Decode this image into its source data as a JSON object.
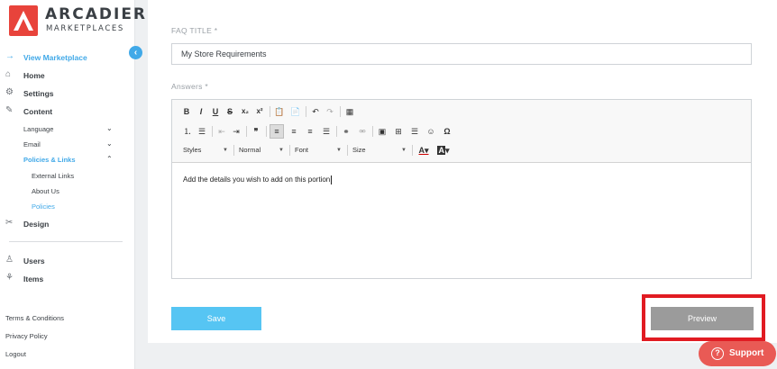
{
  "brand": {
    "name": "ARCADIER",
    "tagline": "MARKETPLACES",
    "color": "#e8433b"
  },
  "sidebar": {
    "collapse_icon": "‹",
    "nav": [
      {
        "label": "View Marketplace",
        "icon": "→",
        "icon_name": "external-link-icon"
      },
      {
        "label": "Home",
        "icon": "⌂",
        "icon_name": "home-icon"
      },
      {
        "label": "Settings",
        "icon": "⚙",
        "icon_name": "gear-icon"
      },
      {
        "label": "Content",
        "icon": "✎",
        "icon_name": "content-edit-icon"
      }
    ],
    "content_sub": [
      {
        "label": "Language",
        "chevron": "⌄"
      },
      {
        "label": "Email",
        "chevron": "⌄"
      },
      {
        "label": "Policies & Links",
        "chevron": "⌃"
      }
    ],
    "policies_sub": [
      {
        "label": "External Links"
      },
      {
        "label": "About Us"
      },
      {
        "label": "Policies"
      }
    ],
    "design": {
      "label": "Design",
      "icon": "✂",
      "icon_name": "design-tools-icon"
    },
    "users": {
      "label": "Users",
      "icon": "♙",
      "icon_name": "user-icon"
    },
    "items": {
      "label": "Items",
      "icon": "⚘",
      "icon_name": "items-icon"
    },
    "footer": [
      "Terms & Conditions",
      "Privacy Policy",
      "Logout"
    ]
  },
  "form": {
    "faq_title_label": "FAQ TITLE *",
    "faq_title_value": "My Store Requirements",
    "answers_label": "Answers *",
    "editor_content": "Add the details you wish to add on this portion",
    "toolbar_dropdowns": {
      "styles": "Styles",
      "format": "Normal",
      "font": "Font",
      "size": "Size"
    },
    "save_label": "Save",
    "preview_label": "Preview"
  },
  "support": {
    "label": "Support",
    "icon": "?"
  },
  "colors": {
    "accent": "#41a9e8",
    "save": "#56c5f3",
    "preview": "#9b9b9b",
    "highlight": "#e11b22",
    "support": "#e95a55"
  }
}
